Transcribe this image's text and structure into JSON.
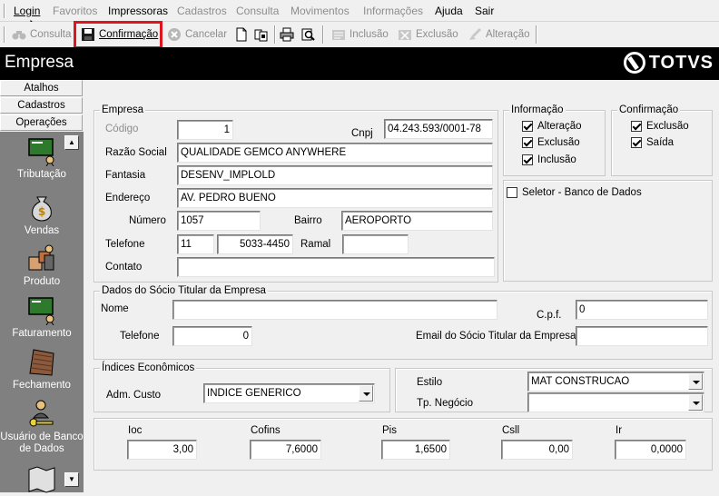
{
  "menu": {
    "items": [
      {
        "label": "Login",
        "enabled": true
      },
      {
        "label": "Favoritos",
        "enabled": false
      },
      {
        "label": "Impressoras",
        "enabled": true
      },
      {
        "label": "Cadastros",
        "enabled": false
      },
      {
        "label": "Consulta",
        "enabled": false
      },
      {
        "label": "Movimentos",
        "enabled": false
      },
      {
        "label": "Informações",
        "enabled": false
      },
      {
        "label": "Ajuda",
        "enabled": true
      },
      {
        "label": "Sair",
        "enabled": true
      }
    ]
  },
  "toolbar": {
    "consulta": "Consulta",
    "confirmacao": "Confirmação",
    "cancelar": "Cancelar",
    "inclusao": "Inclusão",
    "exclusao": "Exclusão",
    "alteracao": "Alteração"
  },
  "header": {
    "title": "Empresa",
    "logo": "TOTVS"
  },
  "nav": {
    "tabs": [
      "Atalhos",
      "Cadastros",
      "Operações"
    ],
    "shortcuts": [
      "Tributação",
      "Vendas",
      "Produto",
      "Faturamento",
      "Fechamento",
      "Usuário de Banco de Dados"
    ]
  },
  "empresa": {
    "group_title": "Empresa",
    "codigo_label": "Código",
    "codigo": "1",
    "cnpj_label": "Cnpj",
    "cnpj": "04.243.593/0001-78",
    "razao_label": "Razão Social",
    "razao": "QUALIDADE GEMCO ANYWHERE",
    "fantasia_label": "Fantasia",
    "fantasia": "DESENV_IMPLOLD",
    "endereco_label": "Endereço",
    "endereco": "AV. PEDRO BUENO",
    "numero_label": "Número",
    "numero": "1057",
    "bairro_label": "Bairro",
    "bairro": "AEROPORTO",
    "telefone_label": "Telefone",
    "ddd": "11",
    "telefone": "5033-4450",
    "ramal_label": "Ramal",
    "ramal": "",
    "contato_label": "Contato",
    "contato": ""
  },
  "informacao": {
    "title": "Informação",
    "alteracao": "Alteração",
    "alteracao_checked": true,
    "exclusao": "Exclusão",
    "exclusao_checked": true,
    "inclusao": "Inclusão",
    "inclusao_checked": true
  },
  "confirmacao": {
    "title": "Confirmação",
    "exclusao": "Exclusão",
    "exclusao_checked": true,
    "saida": "Saída",
    "saida_checked": true
  },
  "seletor": {
    "label": "Seletor - Banco de Dados",
    "checked": false
  },
  "socio": {
    "group_title": "Dados do Sócio Titular da Empresa",
    "nome_label": "Nome",
    "nome": "",
    "cpf_label": "C.p.f.",
    "cpf": "0",
    "telefone_label": "Telefone",
    "telefone": "0",
    "email_label": "Email do Sócio Titular da Empresa",
    "email": ""
  },
  "indices": {
    "group_title": "Índices Econômicos",
    "adm_label": "Adm. Custo",
    "adm_value": "INDICE GENERICO",
    "estilo_label": "Estilo",
    "estilo_value": "MAT CONSTRUCAO",
    "negocio_label": "Tp. Negócio",
    "negocio_value": ""
  },
  "impostos": {
    "ioc_label": "Ioc",
    "ioc": "3,00",
    "cofins_label": "Cofins",
    "cofins": "7,6000",
    "pis_label": "Pis",
    "pis": "1,6500",
    "csll_label": "Csll",
    "csll": "0,00",
    "ir_label": "Ir",
    "ir": "0,0000"
  }
}
